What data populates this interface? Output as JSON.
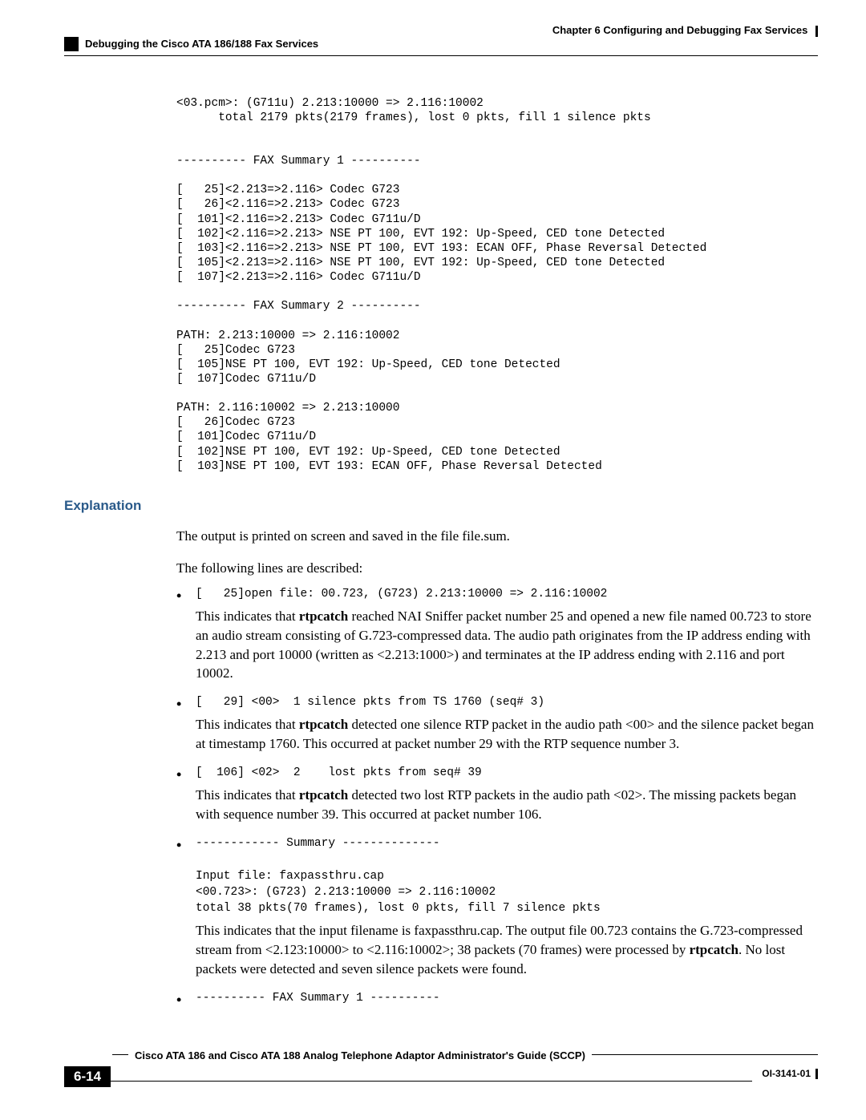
{
  "header": {
    "chapter": "Chapter 6      Configuring and Debugging Fax Services",
    "section": "Debugging the Cisco ATA 186/188 Fax Services"
  },
  "code_block": "<03.pcm>: (G711u) 2.213:10000 => 2.116:10002\n      total 2179 pkts(2179 frames), lost 0 pkts, fill 1 silence pkts\n\n\n---------- FAX Summary 1 ----------\n\n[   25]<2.213=>2.116> Codec G723\n[   26]<2.116=>2.213> Codec G723\n[  101]<2.116=>2.213> Codec G711u/D\n[  102]<2.116=>2.213> NSE PT 100, EVT 192: Up-Speed, CED tone Detected\n[  103]<2.116=>2.213> NSE PT 100, EVT 193: ECAN OFF, Phase Reversal Detected\n[  105]<2.213=>2.116> NSE PT 100, EVT 192: Up-Speed, CED tone Detected\n[  107]<2.213=>2.116> Codec G711u/D\n\n---------- FAX Summary 2 ----------\n\nPATH: 2.213:10000 => 2.116:10002\n[   25]Codec G723\n[  105]NSE PT 100, EVT 192: Up-Speed, CED tone Detected\n[  107]Codec G711u/D\n\nPATH: 2.116:10002 => 2.213:10000\n[   26]Codec G723\n[  101]Codec G711u/D\n[  102]NSE PT 100, EVT 192: Up-Speed, CED tone Detected\n[  103]NSE PT 100, EVT 193: ECAN OFF, Phase Reversal Detected",
  "explanation": {
    "heading": "Explanation",
    "intro1": "The output is printed on screen and saved in the file file.sum.",
    "intro2": "The following lines are described:",
    "bullets": [
      {
        "code": "[   25]open file: 00.723, (G723) 2.213:10000 => 2.116:10002",
        "para_parts": [
          "This indicates that ",
          "rtpcatch",
          " reached NAI Sniffer packet number 25 and opened a new file named 00.723 to store an audio stream consisting of G.723-compressed data. The audio path originates from the IP address ending with 2.213 and port 10000 (written as <2.213:1000>) and terminates at the IP address ending with 2.116 and port 10002."
        ]
      },
      {
        "code": "[   29] <00>  1 silence pkts from TS 1760 (seq# 3)",
        "para_parts": [
          "This indicates that ",
          "rtpcatch",
          " detected one silence RTP packet in the audio path <00> and the silence packet began at timestamp 1760. This occurred at packet number 29 with the RTP sequence number 3."
        ]
      },
      {
        "code": "[  106] <02>  2    lost pkts from seq# 39",
        "para_parts": [
          "This indicates that  ",
          "rtpcatch",
          " detected two lost RTP packets in the audio path <02>.  The missing packets began with sequence number 39. This occurred at packet number 106."
        ]
      },
      {
        "code": "------------ Summary --------------\n\nInput file: faxpassthru.cap\n<00.723>: (G723) 2.213:10000 => 2.116:10002\ntotal 38 pkts(70 frames), lost 0 pkts, fill 7 silence pkts",
        "para_parts": [
          "This indicates that the input filename is faxpassthru.cap.  The output file 00.723 contains the G.723-compressed stream from <2.123:10000> to <2.116:10002>; 38 packets (70 frames) were processed by ",
          "rtpcatch",
          ". No lost packets were detected and seven silence packets were found."
        ]
      },
      {
        "code": "---------- FAX Summary 1 ----------",
        "para_parts": []
      }
    ]
  },
  "footer": {
    "guide_title": "Cisco ATA 186 and Cisco ATA 188 Analog Telephone Adaptor Administrator's Guide (SCCP)",
    "page_number": "6-14",
    "doc_id": "OI-3141-01"
  }
}
